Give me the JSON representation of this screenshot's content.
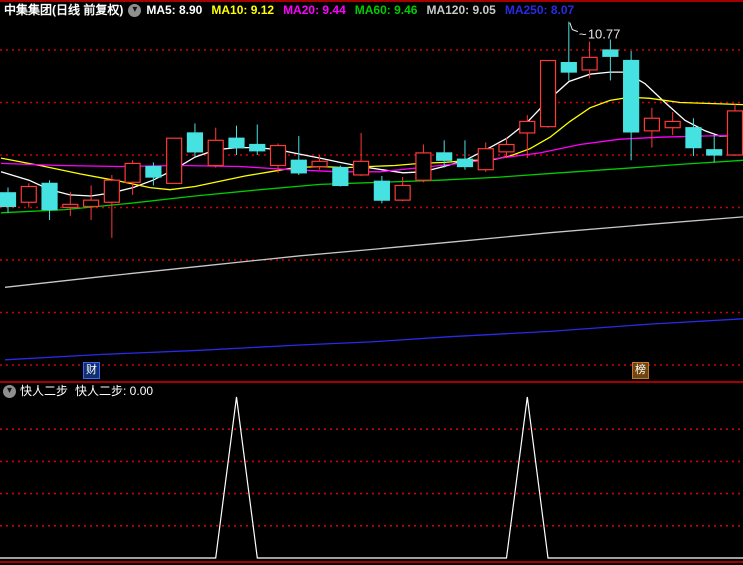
{
  "header": {
    "title": "中集集团(日线 前复权)",
    "ma_labels": [
      {
        "label": "MA5: 8.90",
        "color": "#ffffff"
      },
      {
        "label": "MA10: 9.12",
        "color": "#ffff00"
      },
      {
        "label": "MA20: 9.44",
        "color": "#ff00ff"
      },
      {
        "label": "MA60: 9.46",
        "color": "#00cc00"
      },
      {
        "label": "MA120: 9.05",
        "color": "#c8c8c8"
      },
      {
        "label": "MA250: 8.07",
        "color": "#2a2ae6"
      }
    ]
  },
  "badges": {
    "left": "财",
    "right": "榜"
  },
  "indicator_header": {
    "name": "快人二步",
    "value_label": "快人二步: 0.00"
  },
  "annotation": {
    "pointer": "~",
    "text": "10.77",
    "candle_index": 28,
    "price": 10.77
  },
  "chart_data": {
    "type": "candlestick",
    "title": "中集集团 日线 前复权",
    "colors": {
      "up": "#ff3838",
      "down": "#46e2e2",
      "grid": "#d40000",
      "ma5": "#ffffff",
      "ma10": "#ffff00",
      "ma20": "#ff00ff",
      "ma60": "#00cc00",
      "ma120": "#c8c8c8",
      "ma250": "#2a2ae6",
      "indicator_line": "#ffffff",
      "frame": "#a40000"
    },
    "price_axis": {
      "min": 7.3,
      "max": 10.8,
      "gridlines": [
        10.5,
        10.0,
        9.5,
        9.0,
        8.5,
        8.0,
        7.5
      ]
    },
    "candles_ohlc": [
      [
        9.14,
        9.19,
        8.95,
        9.01
      ],
      [
        9.05,
        9.23,
        9.0,
        9.2
      ],
      [
        9.23,
        9.26,
        8.88,
        8.98
      ],
      [
        9.0,
        9.15,
        8.92,
        9.03
      ],
      [
        9.01,
        9.21,
        8.88,
        9.07
      ],
      [
        9.05,
        9.31,
        8.71,
        9.26
      ],
      [
        9.24,
        9.45,
        9.12,
        9.42
      ],
      [
        9.39,
        9.43,
        9.21,
        9.29
      ],
      [
        9.23,
        9.66,
        9.23,
        9.66
      ],
      [
        9.71,
        9.8,
        9.48,
        9.53
      ],
      [
        9.4,
        9.76,
        9.38,
        9.64
      ],
      [
        9.66,
        9.78,
        9.5,
        9.57
      ],
      [
        9.6,
        9.79,
        9.5,
        9.54
      ],
      [
        9.4,
        9.61,
        9.33,
        9.59
      ],
      [
        9.45,
        9.68,
        9.31,
        9.33
      ],
      [
        9.39,
        9.5,
        9.36,
        9.44
      ],
      [
        9.38,
        9.4,
        9.2,
        9.21
      ],
      [
        9.31,
        9.71,
        9.3,
        9.44
      ],
      [
        9.25,
        9.3,
        9.04,
        9.07
      ],
      [
        9.07,
        9.29,
        9.06,
        9.21
      ],
      [
        9.26,
        9.6,
        9.24,
        9.52
      ],
      [
        9.52,
        9.64,
        9.38,
        9.45
      ],
      [
        9.46,
        9.64,
        9.36,
        9.39
      ],
      [
        9.36,
        9.62,
        9.34,
        9.56
      ],
      [
        9.53,
        9.66,
        9.47,
        9.6
      ],
      [
        9.71,
        9.88,
        9.47,
        9.82
      ],
      [
        9.77,
        10.4,
        9.76,
        10.4
      ],
      [
        10.38,
        10.77,
        10.21,
        10.29
      ],
      [
        10.31,
        10.58,
        10.23,
        10.43
      ],
      [
        10.5,
        10.6,
        10.21,
        10.44
      ],
      [
        10.4,
        10.49,
        9.45,
        9.72
      ],
      [
        9.73,
        9.95,
        9.57,
        9.85
      ],
      [
        9.76,
        9.91,
        9.69,
        9.82
      ],
      [
        9.76,
        9.85,
        9.49,
        9.57
      ],
      [
        9.55,
        9.69,
        9.43,
        9.5
      ],
      [
        9.5,
        9.99,
        9.49,
        9.92
      ]
    ],
    "ma_series": [
      {
        "name": "MA5",
        "color_key": "ma5",
        "points": [
          [
            1,
            9.34
          ],
          [
            29,
            9.26
          ],
          [
            50,
            9.17
          ],
          [
            70,
            9.12
          ],
          [
            91,
            9.11
          ],
          [
            112,
            9.14
          ],
          [
            133,
            9.19
          ],
          [
            153,
            9.26
          ],
          [
            174,
            9.36
          ],
          [
            195,
            9.48
          ],
          [
            216,
            9.55
          ],
          [
            237,
            9.57
          ],
          [
            257,
            9.57
          ],
          [
            278,
            9.55
          ],
          [
            299,
            9.51
          ],
          [
            320,
            9.47
          ],
          [
            340,
            9.43
          ],
          [
            361,
            9.39
          ],
          [
            382,
            9.36
          ],
          [
            403,
            9.33
          ],
          [
            423,
            9.34
          ],
          [
            444,
            9.39
          ],
          [
            465,
            9.45
          ],
          [
            486,
            9.55
          ],
          [
            507,
            9.66
          ],
          [
            527,
            9.81
          ],
          [
            548,
            10.02
          ],
          [
            569,
            10.2
          ],
          [
            590,
            10.27
          ],
          [
            610,
            10.29
          ],
          [
            625,
            10.29
          ],
          [
            645,
            10.18
          ],
          [
            665,
            10.0
          ],
          [
            685,
            9.83
          ],
          [
            705,
            9.73
          ],
          [
            720,
            9.68
          ],
          [
            743,
            9.69
          ]
        ]
      },
      {
        "name": "MA10",
        "color_key": "ma10",
        "points": [
          [
            1,
            9.47
          ],
          [
            40,
            9.4
          ],
          [
            80,
            9.32
          ],
          [
            120,
            9.25
          ],
          [
            150,
            9.19
          ],
          [
            170,
            9.17
          ],
          [
            195,
            9.2
          ],
          [
            220,
            9.25
          ],
          [
            245,
            9.3
          ],
          [
            270,
            9.34
          ],
          [
            295,
            9.38
          ],
          [
            320,
            9.39
          ],
          [
            345,
            9.38
          ],
          [
            370,
            9.39
          ],
          [
            395,
            9.4
          ],
          [
            420,
            9.42
          ],
          [
            445,
            9.43
          ],
          [
            470,
            9.45
          ],
          [
            490,
            9.45
          ],
          [
            510,
            9.49
          ],
          [
            530,
            9.56
          ],
          [
            550,
            9.67
          ],
          [
            570,
            9.82
          ],
          [
            590,
            9.95
          ],
          [
            610,
            10.02
          ],
          [
            630,
            10.05
          ],
          [
            650,
            10.04
          ],
          [
            680,
            10.0
          ],
          [
            710,
            9.99
          ],
          [
            743,
            9.98
          ]
        ]
      },
      {
        "name": "MA20",
        "color_key": "ma20",
        "points": [
          [
            1,
            9.42
          ],
          [
            60,
            9.4
          ],
          [
            120,
            9.39
          ],
          [
            180,
            9.4
          ],
          [
            240,
            9.39
          ],
          [
            290,
            9.36
          ],
          [
            340,
            9.34
          ],
          [
            380,
            9.34
          ],
          [
            420,
            9.38
          ],
          [
            460,
            9.42
          ],
          [
            500,
            9.47
          ],
          [
            540,
            9.52
          ],
          [
            580,
            9.6
          ],
          [
            620,
            9.65
          ],
          [
            660,
            9.67
          ],
          [
            700,
            9.68
          ],
          [
            743,
            9.69
          ]
        ]
      },
      {
        "name": "MA60",
        "color_key": "ma60",
        "points": [
          [
            1,
            8.95
          ],
          [
            65,
            8.98
          ],
          [
            130,
            9.04
          ],
          [
            195,
            9.11
          ],
          [
            260,
            9.17
          ],
          [
            320,
            9.22
          ],
          [
            380,
            9.24
          ],
          [
            440,
            9.26
          ],
          [
            500,
            9.29
          ],
          [
            560,
            9.33
          ],
          [
            620,
            9.37
          ],
          [
            680,
            9.41
          ],
          [
            743,
            9.45
          ]
        ]
      },
      {
        "name": "MA120",
        "color_key": "ma120",
        "points": [
          [
            5,
            8.24
          ],
          [
            100,
            8.34
          ],
          [
            200,
            8.44
          ],
          [
            300,
            8.54
          ],
          [
            371,
            8.6
          ],
          [
            450,
            8.67
          ],
          [
            550,
            8.76
          ],
          [
            650,
            8.84
          ],
          [
            743,
            8.91
          ]
        ]
      },
      {
        "name": "MA250",
        "color_key": "ma250",
        "points": [
          [
            5,
            7.55
          ],
          [
            100,
            7.6
          ],
          [
            200,
            7.64
          ],
          [
            300,
            7.69
          ],
          [
            371,
            7.72
          ],
          [
            450,
            7.77
          ],
          [
            550,
            7.82
          ],
          [
            650,
            7.89
          ],
          [
            743,
            7.94
          ]
        ]
      }
    ],
    "sub_indicator": {
      "name": "快人二步",
      "current_value": 0.0,
      "value_gridlines": [
        20,
        40,
        60,
        80
      ],
      "values": [
        0,
        0,
        0,
        0,
        0,
        0,
        0,
        0,
        0,
        0,
        0,
        100,
        0,
        0,
        0,
        0,
        0,
        0,
        0,
        0,
        0,
        0,
        0,
        0,
        0,
        100,
        0,
        0,
        0,
        0,
        0,
        0,
        0,
        0,
        0,
        0
      ]
    }
  }
}
